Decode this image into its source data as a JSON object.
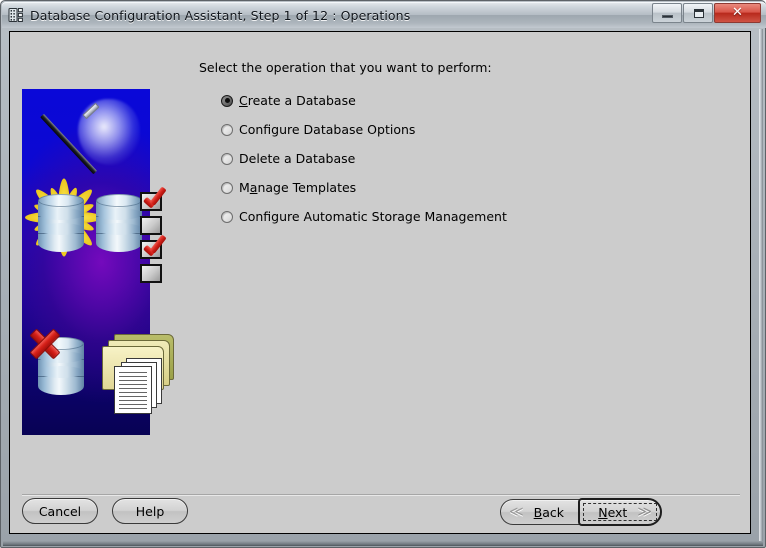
{
  "window": {
    "title": "Database Configuration Assistant, Step 1 of 12 : Operations",
    "app_icon": "database-server-icon",
    "controls": {
      "minimize_label": "–",
      "maximize_label": "□",
      "close_label": "✕",
      "minimize_name": "minimize-button",
      "maximize_name": "maximize-button",
      "close_name": "close-button"
    }
  },
  "illustration": {
    "alt": "Database Configuration Assistant wizard illustration with magic wand, sparkle, database cylinders, red X, checklist and folders",
    "background_top_color": "#0a08d8",
    "background_mid_color": "#7c0abe",
    "background_bottom_color": "#080254"
  },
  "main": {
    "prompt": "Select the operation that you want to perform:",
    "selected_option": "Create a Database",
    "options": [
      {
        "label": "Create a Database",
        "selected": true,
        "mnemonic": "C"
      },
      {
        "label": "Configure Database Options",
        "selected": false,
        "mnemonic": ""
      },
      {
        "label": "Delete a Database",
        "selected": false,
        "mnemonic": ""
      },
      {
        "label": "Manage Templates",
        "selected": false,
        "mnemonic": "a"
      },
      {
        "label": "Configure Automatic Storage Management",
        "selected": false,
        "mnemonic": ""
      }
    ]
  },
  "footer": {
    "cancel_label": "Cancel",
    "help_label": "Help",
    "back_label": "Back",
    "back_mnemonic": "B",
    "next_label": "Next",
    "next_mnemonic": "N",
    "back_chevron": "≪",
    "next_chevron": "≫"
  },
  "wizard": {
    "step_current": 1,
    "step_total": 12,
    "step_name": "Operations"
  }
}
